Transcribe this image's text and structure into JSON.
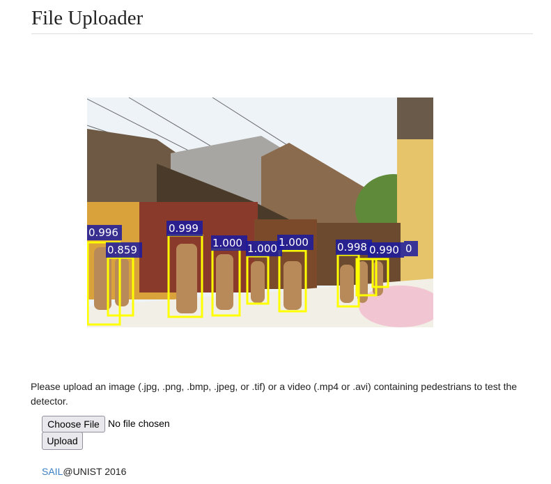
{
  "page": {
    "title": "File Uploader",
    "description": "Please upload an image (.jpg, .png, .bmp, .jpeg, or .tif) or a video (.mp4 or .avi) containing pedestrians to test the detector."
  },
  "form": {
    "choose_file_label": "Choose File",
    "no_file_text": "No file chosen",
    "upload_label": "Upload"
  },
  "footer": {
    "lab_link": "SAIL",
    "suffix": "@UNIST 2016"
  },
  "detections": [
    {
      "score": "0.996"
    },
    {
      "score": "0.859"
    },
    {
      "score": "0.999"
    },
    {
      "score": "1.000"
    },
    {
      "score": "1.000"
    },
    {
      "score": "1.000"
    },
    {
      "score": "0.998"
    },
    {
      "score": "0.990"
    },
    {
      "score": "0"
    }
  ],
  "colors": {
    "box": "#ffff00",
    "label_bg": "#1a1aa0",
    "link": "#3b7fc4"
  }
}
